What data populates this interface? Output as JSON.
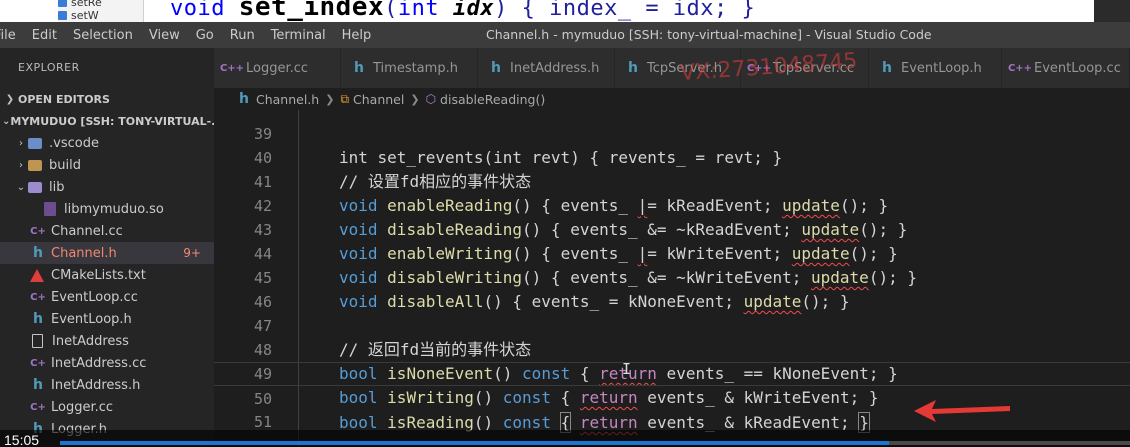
{
  "background_video": {
    "files": [
      "setRe",
      "setW"
    ],
    "code": {
      "kw": "void",
      "fn": "set_index",
      "open": "(",
      "type": "int",
      "param": "idx",
      "body": ") { index_ = idx; }"
    }
  },
  "window": {
    "title": "Channel.h - mymuduo [SSH: tony-virtual-machine] - Visual Studio Code",
    "menu": [
      "File",
      "Edit",
      "Selection",
      "View",
      "Go",
      "Run",
      "Terminal",
      "Help"
    ]
  },
  "sidebar": {
    "header": "EXPLORER",
    "open_editors": "OPEN EDITORS",
    "project": "MYMUDUO [SSH: TONY-VIRTUAL-...",
    "items": [
      {
        "label": "vscode",
        "prefix": ".",
        "kind": "folder"
      },
      {
        "label": "build",
        "kind": "folder"
      },
      {
        "label": "lib",
        "kind": "folder-open"
      },
      {
        "label": "libmymuduo.so",
        "kind": "so"
      },
      {
        "label": "Channel.cc",
        "kind": "cpp"
      },
      {
        "label": "Channel.h",
        "kind": "h",
        "badge": "9+"
      },
      {
        "label": "CMakeLists.txt",
        "kind": "cmake"
      },
      {
        "label": "EventLoop.cc",
        "kind": "cpp"
      },
      {
        "label": "EventLoop.h",
        "kind": "h"
      },
      {
        "label": "InetAddress",
        "kind": "file"
      },
      {
        "label": "InetAddress.cc",
        "kind": "cpp"
      },
      {
        "label": "InetAddress.h",
        "kind": "h"
      },
      {
        "label": "Logger.cc",
        "kind": "cpp"
      },
      {
        "label": "Logger.h",
        "kind": "h"
      }
    ]
  },
  "tabs": [
    {
      "label": "Logger.cc",
      "icon": "C++"
    },
    {
      "label": "Timestamp.h",
      "icon": "h"
    },
    {
      "label": "InetAddress.h",
      "icon": "h"
    },
    {
      "label": "TcpServer.h",
      "icon": "h"
    },
    {
      "label": "TcpServer.cc",
      "icon": "C++"
    },
    {
      "label": "EventLoop.h",
      "icon": "h"
    },
    {
      "label": "EventLoop.cc",
      "icon": "C++"
    }
  ],
  "breadcrumb": {
    "file": "Channel.h",
    "class": "Channel",
    "method": "disableReading()"
  },
  "code": {
    "l39": {
      "num": "39",
      "text": "int set_revents(int revt) { revents_ = revt; }"
    },
    "l40": {
      "num": "40",
      "text": "// 设置fd相应的事件状态"
    },
    "l41": {
      "num": "41"
    },
    "l42": {
      "num": "42"
    },
    "l43": {
      "num": "43"
    },
    "l44": {
      "num": "44"
    },
    "l45": {
      "num": "45"
    },
    "l46": {
      "num": "46"
    },
    "l47": {
      "num": "47",
      "text": "// 返回fd当前的事件状态"
    },
    "l48": {
      "num": "48"
    },
    "l49": {
      "num": "49"
    },
    "l50": {
      "num": "50"
    },
    "l51": {
      "num": "51"
    }
  },
  "watermark": "VX:2731048745",
  "video": {
    "time": "15:05",
    "progress": 0.775
  }
}
